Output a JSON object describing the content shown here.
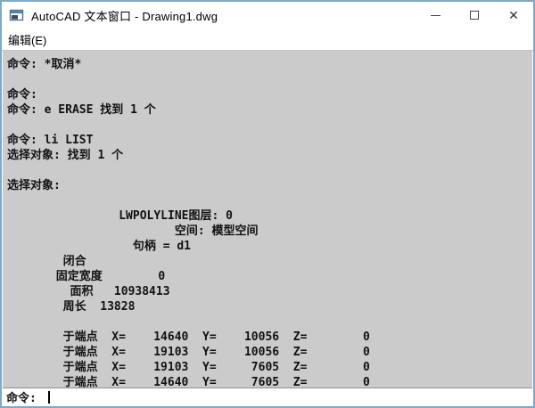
{
  "window": {
    "title": "AutoCAD 文本窗口 - Drawing1.dwg",
    "minimize_glyph": "",
    "maximize_glyph": "",
    "close_glyph": "✕"
  },
  "menu": {
    "edit_label": "编辑(E)"
  },
  "terminal": {
    "lines": [
      "命令: *取消*",
      "",
      "命令:",
      "命令: e ERASE 找到 1 个",
      "",
      "命令: li LIST",
      "选择对象: 找到 1 个",
      "",
      "选择对象:",
      "",
      "                LWPOLYLINE图层: 0",
      "                        空间: 模型空间",
      "                  句柄 = d1",
      "        闭合",
      "       固定宽度        0",
      "         面积   10938413",
      "        周长  13828",
      "",
      "        于端点  X=    14640  Y=    10056  Z=        0",
      "        于端点  X=    19103  Y=    10056  Z=        0",
      "        于端点  X=    19103  Y=     7605  Z=        0",
      "        于端点  X=    14640  Y=     7605  Z=        0"
    ],
    "list_entity": {
      "type": "LWPOLYLINE",
      "layer": "0",
      "space": "模型空间",
      "handle": "d1",
      "closed": "闭合",
      "constant_width": "0",
      "area": "10938413",
      "perimeter": "13828",
      "vertices": [
        {
          "x": "14640",
          "y": "10056",
          "z": "0"
        },
        {
          "x": "19103",
          "y": "10056",
          "z": "0"
        },
        {
          "x": "19103",
          "y": "7605",
          "z": "0"
        },
        {
          "x": "14640",
          "y": "7605",
          "z": "0"
        }
      ]
    },
    "prompt": "命令: "
  },
  "colors": {
    "window_border": "#7aa9cc",
    "titlebar_bg": "#ffffff",
    "terminal_bg": "#cbcbcb",
    "terminal_text": "#121212",
    "input_bg": "#ffffff"
  }
}
